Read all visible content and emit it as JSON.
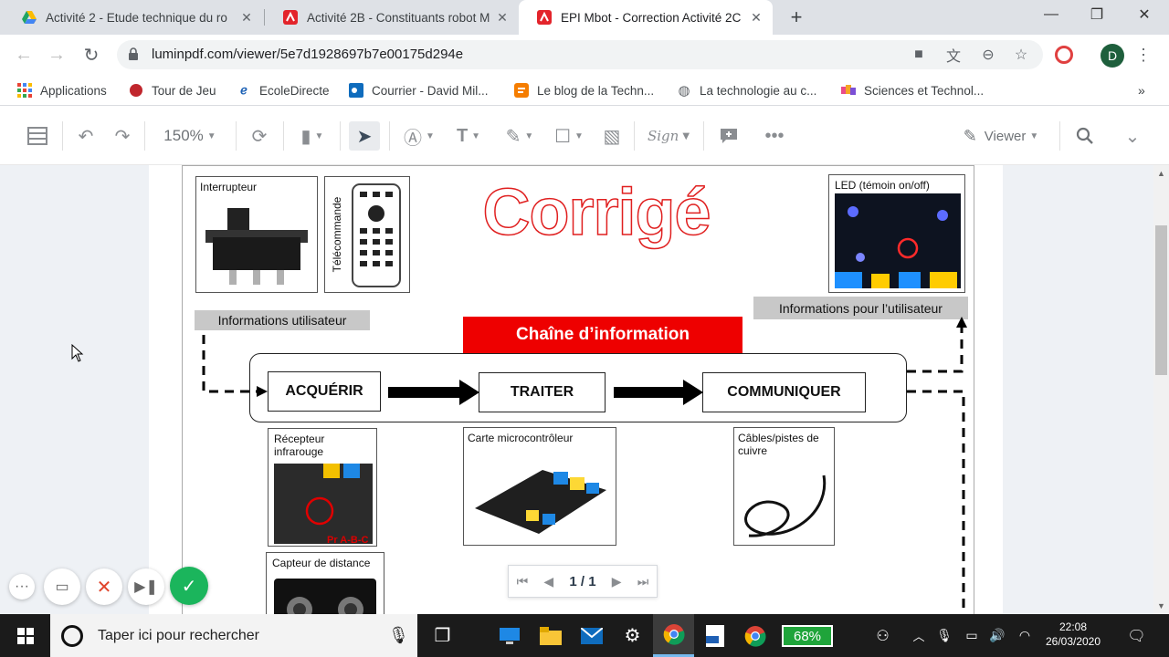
{
  "tabs": [
    {
      "title": "Activité 2 - Etude technique du ro",
      "icon": "google-drive-icon"
    },
    {
      "title": "Activité 2B - Constituants robot M",
      "icon": "lumin-pdf-icon"
    },
    {
      "title": "EPI Mbot - Correction Activité 2C",
      "icon": "lumin-pdf-icon",
      "active": true
    }
  ],
  "address": {
    "url": "luminpdf.com/viewer/5e7d1928697b7e00175d294e"
  },
  "profile_initial": "D",
  "bookmarks": [
    {
      "label": "Applications",
      "icon": "apps-grid-icon"
    },
    {
      "label": "Tour de Jeu",
      "icon": "bookmark-favicon-icon"
    },
    {
      "label": "EcoleDirecte",
      "icon": "ecoledirecte-icon"
    },
    {
      "label": "Courrier - David Mil...",
      "icon": "outlook-icon"
    },
    {
      "label": "Le blog de la Techn...",
      "icon": "blogger-icon"
    },
    {
      "label": "La technologie au c...",
      "icon": "globe-icon"
    },
    {
      "label": "Sciences et Technol...",
      "icon": "bookmark-favicon-icon"
    }
  ],
  "toolbar": {
    "zoom": "150%",
    "viewer_label": "Viewer",
    "sign_label": "Sign"
  },
  "doc": {
    "title": "Corrigé",
    "interrupteur": "Interrupteur",
    "telecommande": "Télécommande",
    "led": "LED (témoin on/off)",
    "info_user_right": "Informations pour l’utilisateur",
    "info_user_left": "Informations utilisateur",
    "chaine": "Chaîne d’information",
    "acquerir": "ACQUÉRIR",
    "traiter": "TRAITER",
    "communiquer": "COMMUNIQUER",
    "recepteur": "Récepteur infrarouge",
    "recepteur_tag": "Pr A-B-C",
    "carte": "Carte microcontrôleur",
    "cables": "Câbles/pistes de cuivre",
    "capteur": "Capteur de distance"
  },
  "pager": {
    "text": "1 / 1"
  },
  "taskbar": {
    "search_placeholder": "Taper ici pour rechercher",
    "battery": "68%",
    "time": "22:08",
    "date": "26/03/2020"
  },
  "colors": {
    "accent_red": "#ee0000",
    "tab_bg": "#dee1e6",
    "confirm_green": "#1bb55c"
  }
}
